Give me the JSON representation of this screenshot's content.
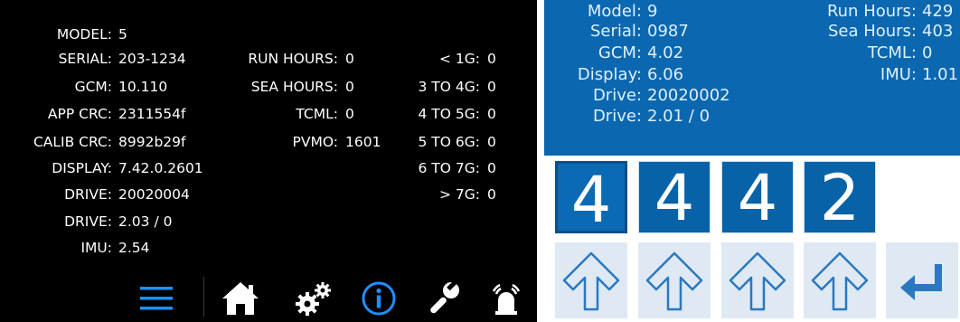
{
  "left_panel": {
    "col1": [
      {
        "label": "MODEL:",
        "value": "5"
      },
      {
        "label": "SERIAL:",
        "value": "203-1234"
      },
      {
        "label": "GCM:",
        "value": "10.110"
      },
      {
        "label": "APP CRC:",
        "value": "2311554f"
      },
      {
        "label": "CALIB CRC:",
        "value": "8992b29f"
      },
      {
        "label": "DISPLAY:",
        "value": "7.42.0.2601"
      },
      {
        "label": "DRIVE:",
        "value": "20020004"
      },
      {
        "label": "DRIVE:",
        "value": "2.03 / 0"
      },
      {
        "label": "IMU:",
        "value": "2.54"
      }
    ],
    "col2": [
      {
        "label": "RUN HOURS:",
        "value": "0"
      },
      {
        "label": "SEA HOURS:",
        "value": "0"
      },
      {
        "label": "TCML:",
        "value": "0"
      },
      {
        "label": "PVMO:",
        "value": "1601"
      }
    ],
    "col3": [
      {
        "label": "< 1G:",
        "value": "0"
      },
      {
        "label": "3 TO 4G:",
        "value": "0"
      },
      {
        "label": "4 TO 5G:",
        "value": "0"
      },
      {
        "label": "5 TO 6G:",
        "value": "0"
      },
      {
        "label": "6 TO 7G:",
        "value": "0"
      },
      {
        "label": "> 7G:",
        "value": "0"
      }
    ],
    "nav": {
      "icons": [
        "menu-icon",
        "home-icon",
        "gears-icon",
        "info-icon",
        "wrench-icon",
        "alarm-icon"
      ],
      "active": "info-icon",
      "accent_color": "#1e90ff",
      "icon_color": "#ffffff"
    }
  },
  "right_panel": {
    "colors": {
      "top_bg": "#0a67b0",
      "text": "#dff0ff",
      "button_bg": "#dfe9f3",
      "arrow": "#2a78c0"
    },
    "left_info": [
      {
        "label": "Model:",
        "value": "9"
      },
      {
        "label": "Serial:",
        "value": "0987"
      },
      {
        "label": "GCM:",
        "value": "4.02"
      },
      {
        "label": "Display:",
        "value": "6.06"
      },
      {
        "label": "Drive:",
        "value": "20020002"
      },
      {
        "label": "Drive:",
        "value": "2.01 / 0"
      }
    ],
    "right_info": [
      {
        "label": "Run Hours:",
        "value": "429"
      },
      {
        "label": "Sea Hours:",
        "value": "403"
      },
      {
        "label": "TCML:",
        "value": "0"
      },
      {
        "label": "IMU:",
        "value": "1.01"
      }
    ],
    "digits": [
      "4",
      "4",
      "4",
      "2"
    ],
    "selected_digit_index": 0
  }
}
